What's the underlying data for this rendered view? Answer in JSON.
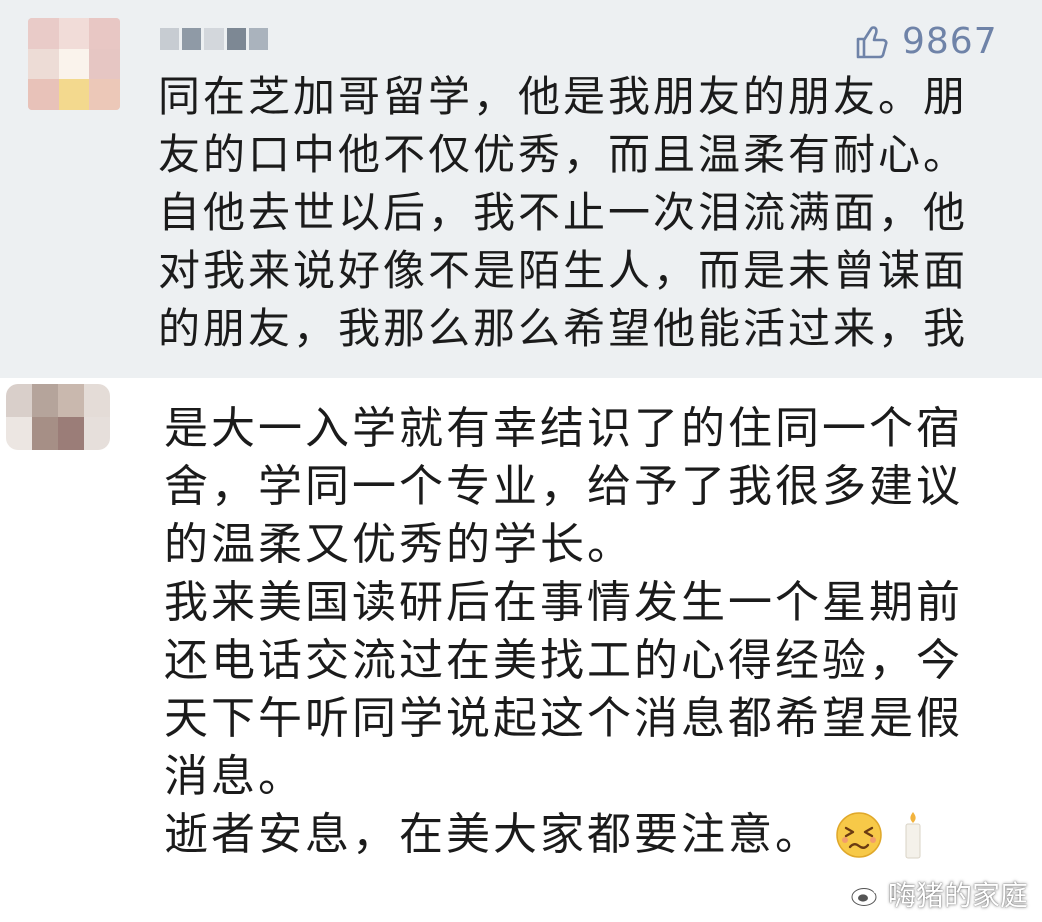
{
  "comments": [
    {
      "likes": "9867",
      "lines": [
        "同在芝加哥留学，他是我朋友的朋友。朋",
        "友的口中他不仅优秀，而且温柔有耐心。",
        "自他去世以后，我不止一次泪流满面，他",
        "对我来说好像不是陌生人，而是未曾谋面",
        "的朋友，我那么那么希望他能活过来，我"
      ]
    },
    {
      "lines": [
        "是大一入学就有幸结识了的住同一个宿",
        "舍，学同一个专业，给予了我很多建议",
        "的温柔又优秀的学长。",
        "我来美国读研后在事情发生一个星期前",
        "还电话交流过在美找工的心得经验，今",
        "天下午听同学说起这个消息都希望是假",
        "消息。"
      ],
      "last_line": "逝者安息，在美大家都要注意。",
      "emojis": [
        "crying-face-icon",
        "candle-icon"
      ]
    }
  ],
  "watermark": "嗨猪的家庭",
  "colors": {
    "first_comment_bg": "#edf0f2",
    "second_comment_bg": "#ffffff",
    "like_color": "#6f83a8",
    "text_color": "#1b1b1b"
  }
}
